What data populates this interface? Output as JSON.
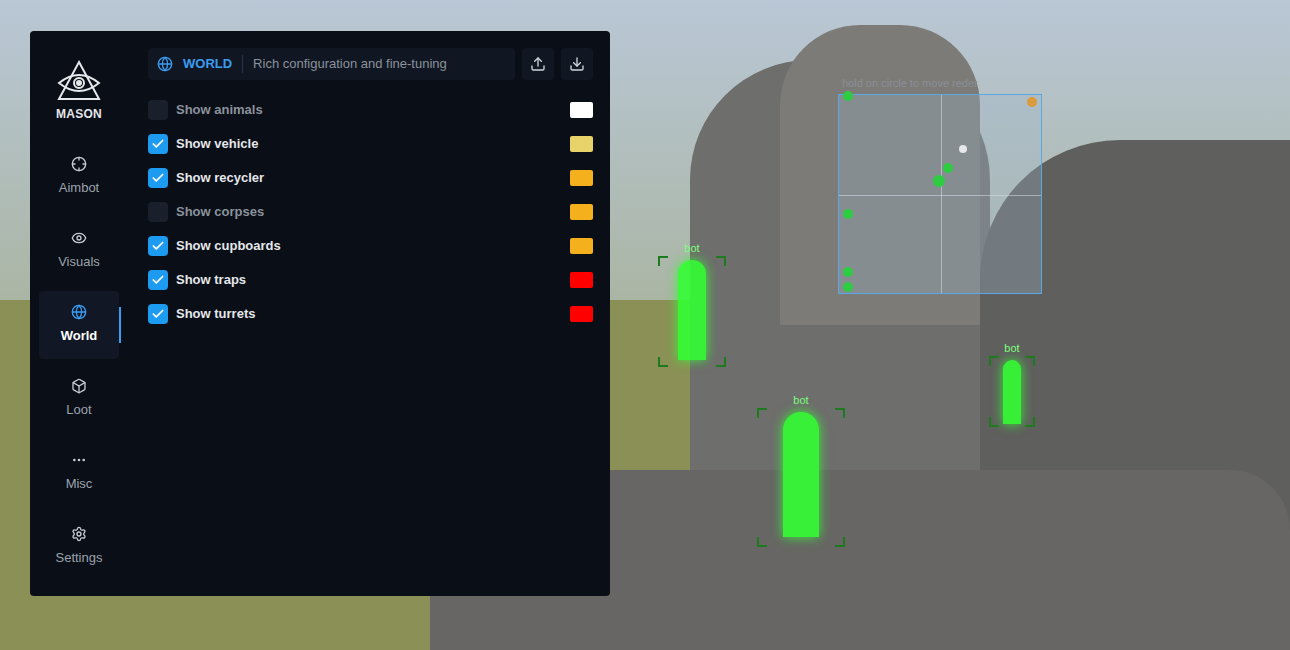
{
  "app": {
    "name": "MASON"
  },
  "sidebar": {
    "items": [
      {
        "label": "Aimbot",
        "selected": false
      },
      {
        "label": "Visuals",
        "selected": false
      },
      {
        "label": "World",
        "selected": true
      },
      {
        "label": "Loot",
        "selected": false
      },
      {
        "label": "Misc",
        "selected": false
      },
      {
        "label": "Settings",
        "selected": false
      }
    ]
  },
  "header": {
    "title": "WORLD",
    "subtitle": "Rich configuration and fine-tuning"
  },
  "options": [
    {
      "label": "Show animals",
      "checked": false,
      "color": "#ffffff"
    },
    {
      "label": "Show vehicle",
      "checked": true,
      "color": "#e8d36a"
    },
    {
      "label": "Show recycler",
      "checked": true,
      "color": "#f5b01e"
    },
    {
      "label": "Show corpses",
      "checked": false,
      "color": "#f5b01e"
    },
    {
      "label": "Show cupboards",
      "checked": true,
      "color": "#f5b01e"
    },
    {
      "label": "Show traps",
      "checked": true,
      "color": "#ff0000"
    },
    {
      "label": "Show turrets",
      "checked": true,
      "color": "#ff0000"
    }
  ],
  "overlay": {
    "radar_hint": "hold on circle to move reder",
    "players": [
      {
        "label": "bot"
      },
      {
        "label": "bot"
      },
      {
        "label": "bot"
      }
    ]
  }
}
